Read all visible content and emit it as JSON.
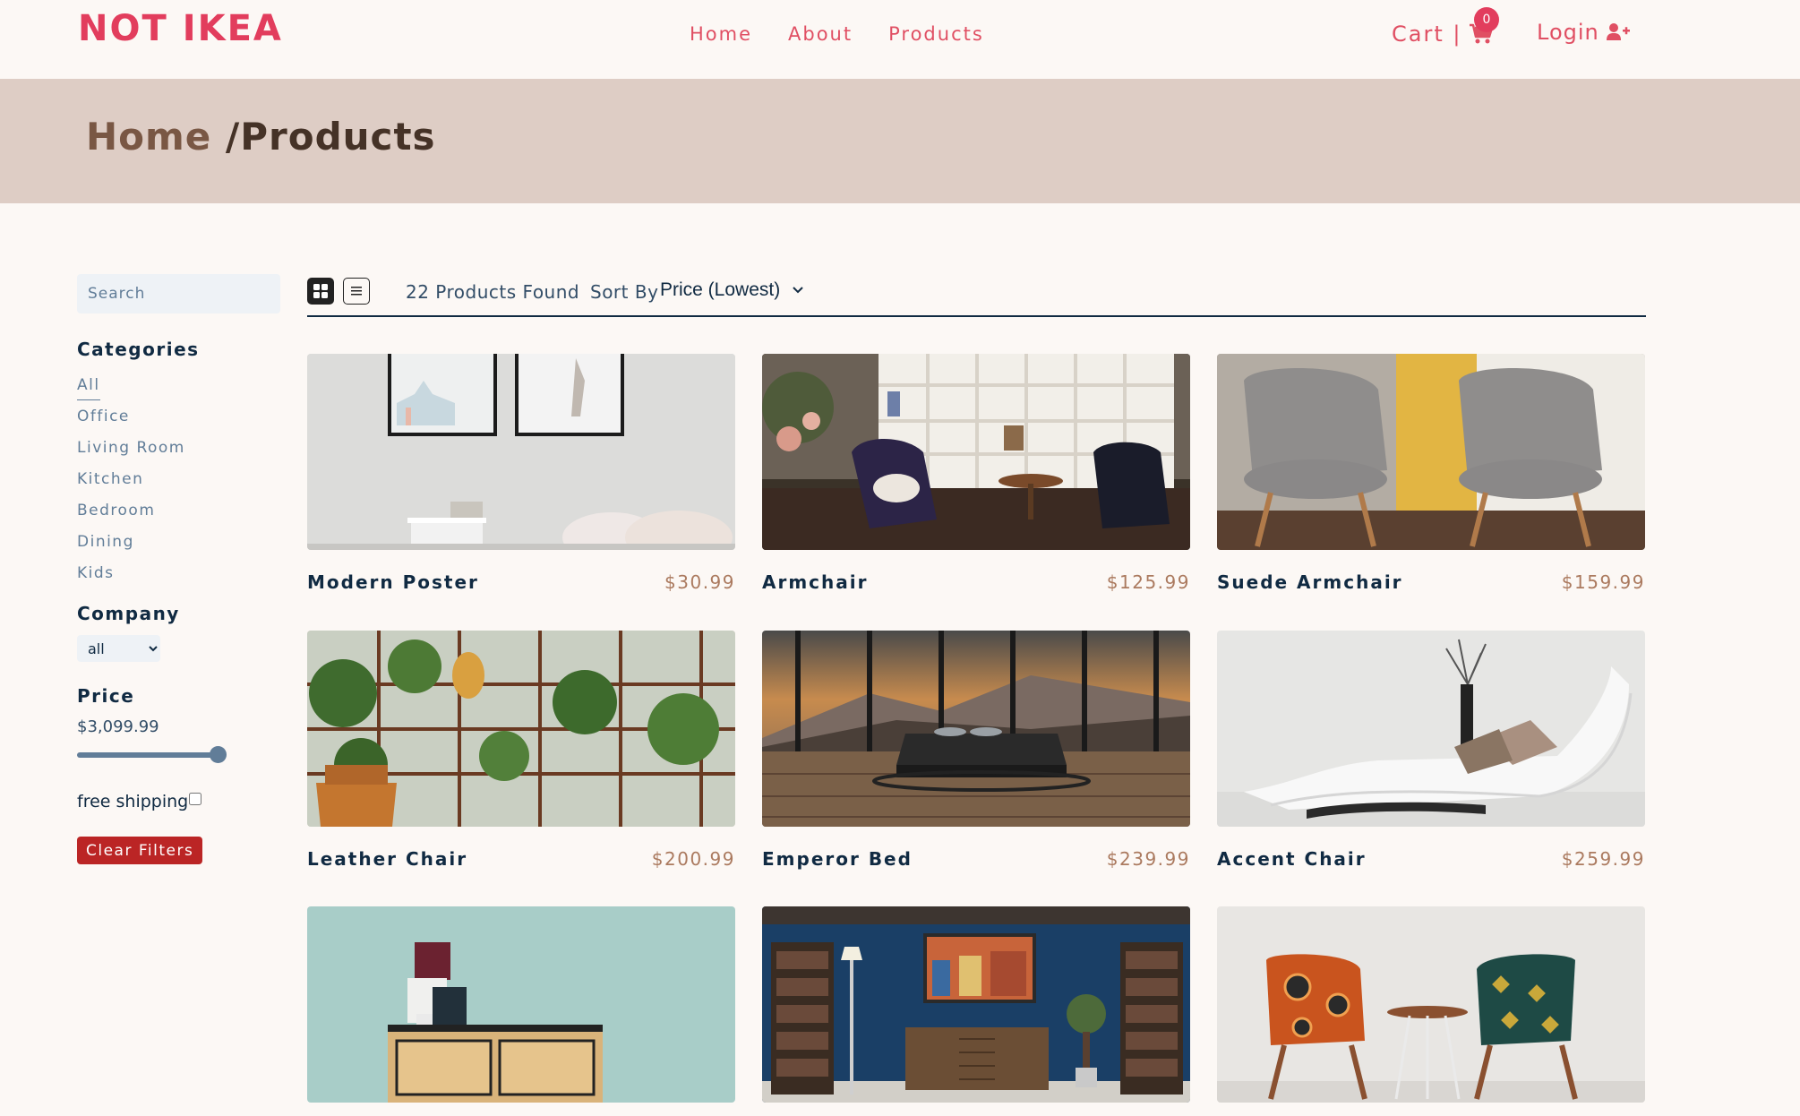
{
  "navbar": {
    "logo": "NOT IKEA",
    "links": [
      "Home",
      "About",
      "Products"
    ],
    "cart_label": "Cart |",
    "cart_count": "0",
    "login_label": "Login",
    "cart_icon": "shopping-cart-icon",
    "login_icon": "user-plus-icon"
  },
  "hero": {
    "home": "Home",
    "current": "/Products"
  },
  "filters": {
    "search_placeholder": "Search",
    "categories_title": "Categories",
    "categories": [
      "All",
      "Office",
      "Living Room",
      "Kitchen",
      "Bedroom",
      "Dining",
      "Kids"
    ],
    "active_category": "All",
    "company_title": "Company",
    "company_selected": "all",
    "price_title": "Price",
    "price_value": "$3,099.99",
    "price_slider_fraction": 1.0,
    "shipping_label": "free shipping",
    "shipping_checked": false,
    "clear_label": "Clear Filters"
  },
  "toolbar": {
    "count_text": "22 Products Found",
    "sort_label": "Sort By",
    "sort_selected": "Price (Lowest)",
    "grid_icon": "grid-view-icon",
    "list_icon": "list-view-icon"
  },
  "products": [
    {
      "name": "Modern Poster",
      "price": "$30.99"
    },
    {
      "name": "Armchair",
      "price": "$125.99"
    },
    {
      "name": "Suede Armchair",
      "price": "$159.99"
    },
    {
      "name": "Leather Chair",
      "price": "$200.99"
    },
    {
      "name": "Emperor Bed",
      "price": "$239.99"
    },
    {
      "name": "Accent Chair",
      "price": "$259.99"
    },
    {
      "name": "",
      "price": ""
    },
    {
      "name": "",
      "price": ""
    },
    {
      "name": "",
      "price": ""
    }
  ],
  "colors": {
    "brand": "#e23d5d",
    "hero_bg": "#decdc5",
    "price": "#ab7a5f",
    "clear_button": "#bb2525"
  }
}
